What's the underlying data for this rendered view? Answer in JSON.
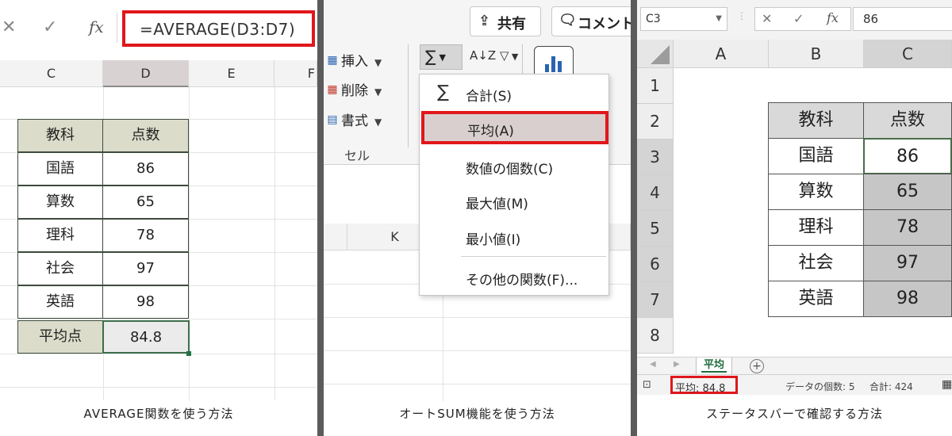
{
  "panel1": {
    "formula_bar": {
      "cancel_icon": "✕",
      "enter_icon": "✓",
      "fx_label": "fx",
      "formula": "=AVERAGE(D3:D7)"
    },
    "columns": [
      "C",
      "D",
      "E",
      "F"
    ],
    "table": {
      "headers": [
        "教科",
        "点数"
      ],
      "rows": [
        [
          "国語",
          "86"
        ],
        [
          "算数",
          "65"
        ],
        [
          "理科",
          "78"
        ],
        [
          "社会",
          "97"
        ],
        [
          "英語",
          "98"
        ]
      ],
      "avg_label": "平均点",
      "avg_value": "84.8"
    },
    "caption": "AVERAGE関数を使う方法"
  },
  "panel2": {
    "share_label": "共有",
    "comment_label": "コメント",
    "cells_group": {
      "insert": "挿入",
      "delete": "削除",
      "format": "書式",
      "group_label": "セル"
    },
    "autosum_icon": "∑",
    "sort_icon": "A↓Z",
    "column_k": "K",
    "menu": [
      {
        "label": "合計(S)",
        "icon": "∑"
      },
      {
        "label": "平均(A)"
      },
      {
        "label": "数値の個数(C)"
      },
      {
        "label": "最大値(M)"
      },
      {
        "label": "最小値(I)"
      },
      {
        "label": "その他の関数(F)..."
      }
    ],
    "caption": "オートSUM機能を使う方法"
  },
  "panel3": {
    "name_box": "C3",
    "fx_label": "fx",
    "formula_value": "86",
    "columns": [
      "A",
      "B",
      "C"
    ],
    "rows": [
      "1",
      "2",
      "3",
      "4",
      "5",
      "6",
      "7",
      "8"
    ],
    "table": {
      "headers": [
        "教科",
        "点数"
      ],
      "rows": [
        [
          "国語",
          "86"
        ],
        [
          "算数",
          "65"
        ],
        [
          "理科",
          "78"
        ],
        [
          "社会",
          "97"
        ],
        [
          "英語",
          "98"
        ]
      ]
    },
    "sheet_tab": "平均",
    "status": {
      "average": "平均: 84.8",
      "count": "データの個数: 5",
      "sum": "合計: 424"
    },
    "caption": "ステータスバーで確認する方法"
  },
  "colors": {
    "highlight_red": "#e0171b",
    "header_fill": "#dcdccb",
    "excel_green": "#217346"
  }
}
